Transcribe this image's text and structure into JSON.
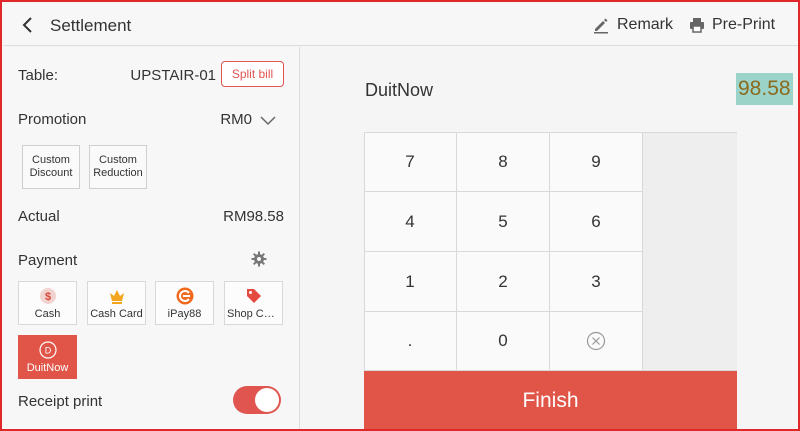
{
  "header": {
    "title": "Settlement",
    "remark_label": "Remark",
    "preprint_label": "Pre-Print"
  },
  "left": {
    "table_label": "Table:",
    "table_value": "UPSTAIR-01",
    "split_bill_label": "Split bill",
    "promotion_label": "Promotion",
    "promotion_value": "RM0",
    "custom_discount_line1": "Custom",
    "custom_discount_line2": "Discount",
    "custom_reduction_line1": "Custom",
    "custom_reduction_line2": "Reduction",
    "actual_label": "Actual",
    "actual_value": "RM98.58",
    "payment_label": "Payment",
    "payment_methods": [
      {
        "label": "Cash",
        "icon": "dollar-icon"
      },
      {
        "label": "Cash Card",
        "icon": "crown-icon"
      },
      {
        "label": "iPay88",
        "icon": "ipay88-icon"
      },
      {
        "label": "Shop Cou...",
        "icon": "tag-icon"
      },
      {
        "label": "DuitNow",
        "icon": "duitnow-icon",
        "active": true
      }
    ],
    "duitnow_icon_letter": "D",
    "receipt_print_label": "Receipt print",
    "receipt_print_on": true
  },
  "right": {
    "method_name": "DuitNow",
    "amount": "98.58",
    "keys": [
      "7",
      "8",
      "9",
      "4",
      "5",
      "6",
      "1",
      "2",
      "3",
      ".",
      "0"
    ],
    "finish_label": "Finish"
  },
  "colors": {
    "accent": "#e05548",
    "amount_highlight": "#9bd3c9",
    "amount_text": "#8a6a1e"
  }
}
